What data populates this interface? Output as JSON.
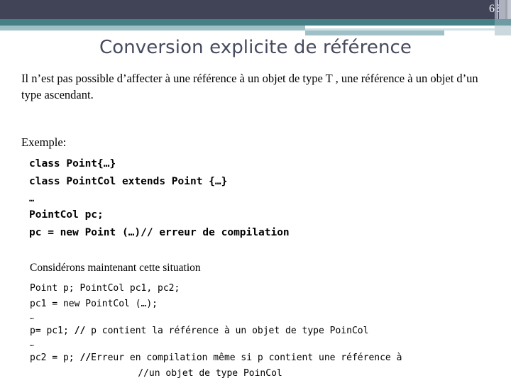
{
  "header": {
    "slide_number": "63",
    "dark_band_color": "#414457",
    "teal_band_color": "#448086",
    "light_band_color": "#9fc0c7",
    "pale_band_color": "#cfe0e4"
  },
  "title": {
    "text": "Conversion explicite de référence",
    "color": "#464a5e"
  },
  "body": {
    "intro_paragraph": "Il n’est pas possible d’affecter à une référence à un objet de type T , une référence à un objet d’un type ascendant.",
    "example_label": "Exemple:",
    "code_block_1": [
      "class Point{…}",
      "class PointCol extends Point {…}",
      "…",
      "PointCol pc;",
      "pc = new Point (…)// erreur de compilation"
    ],
    "consider_label": "Considérons maintenant cette situation",
    "code_block_2": [
      "Point p; PointCol pc1, pc2;",
      "pc1 = new PointCol (…);",
      "…",
      "p= pc1; // p contient la référence à un objet de type PoinCol",
      "…",
      "pc2 = p; // Erreur en compilation même si p contient une référence à",
      "//un objet de type PoinCol"
    ],
    "code_2_line_1": "Point p; PointCol pc1, pc2;",
    "code_2_line_2": "pc1 = new PointCol (…);",
    "code_2_ellipsis_1": "…",
    "code_2_line_3_mark": "//",
    "code_2_line_3_a": "p= pc1; ",
    "code_2_line_3_b": " p contient la référence à un objet de type PoinCol",
    "code_2_ellipsis_2": "…",
    "code_2_line_4_a": "pc2 = p; ",
    "code_2_line_4_mark": "//",
    "code_2_line_4_b": "Erreur en compilation même si p contient une référence à",
    "code_2_line_5": "//un objet de type PoinCol"
  }
}
